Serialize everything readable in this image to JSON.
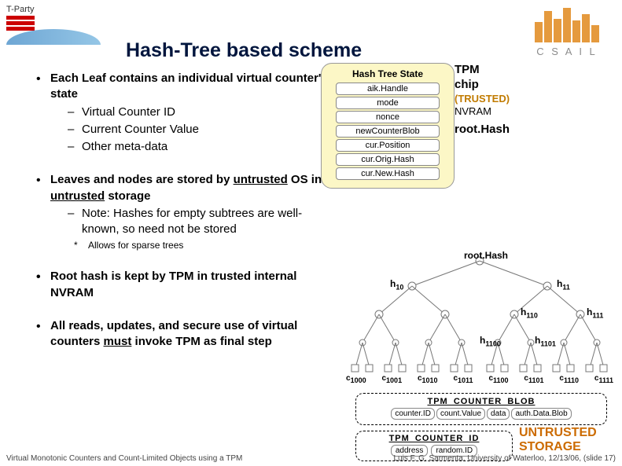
{
  "logos": {
    "left_label": "T-Party",
    "right_label": "C S A I L"
  },
  "title": "Hash-Tree based scheme",
  "hashtree_state": {
    "label": "Hash Tree State",
    "fields": [
      "aik.Handle",
      "mode",
      "nonce",
      "newCounterBlob",
      "cur.Position",
      "cur.Orig.Hash",
      "cur.New.Hash"
    ]
  },
  "tpm": {
    "title1": "TPM",
    "title2": "chip",
    "trusted": "(TRUSTED)",
    "nvram": "NVRAM",
    "roothash": "root.Hash"
  },
  "bullets": {
    "b1": {
      "main_a": "Each Leaf contains an individual virtual counter's state",
      "s1": "Virtual Counter ID",
      "s2": "Current Counter Value",
      "s3": "Other meta-data"
    },
    "b2": {
      "main": "Leaves and nodes are stored by untrusted OS in untrusted storage",
      "s1": "Note: Hashes for empty subtrees are well-known, so need not be stored",
      "ss1": "Allows for sparse trees"
    },
    "b3": "Root hash is kept by TPM in trusted internal NVRAM",
    "b4": "All reads, updates, and secure use of virtual counters must invoke TPM as final step"
  },
  "tree": {
    "root": "root.Hash",
    "h10": "h",
    "h10s": "10",
    "h11": "h",
    "h11s": "11",
    "h110": "h",
    "h110s": "110",
    "h111": "h",
    "h111s": "111",
    "h1100": "h",
    "h1100s": "1100",
    "h1101": "h",
    "h1101s": "1101",
    "leaves": [
      "c",
      "c",
      "c",
      "c",
      "c",
      "c",
      "c",
      "c"
    ],
    "leaf_subs": [
      "1000",
      "1001",
      "1010",
      "1011",
      "1100",
      "1101",
      "1110",
      "1111"
    ]
  },
  "blob": {
    "label": "TPM_COUNTER_BLOB",
    "cells": [
      "counter.ID",
      "count.Value",
      "data",
      "auth.Data.Blob"
    ]
  },
  "idbox": {
    "label": "TPM_COUNTER_ID",
    "cells": [
      "address",
      "random.ID"
    ]
  },
  "untrusted": {
    "l1": "UNTRUSTED",
    "l2": "STORAGE"
  },
  "footer": {
    "left": "Virtual Monotonic Counters and Count-Limited Objects using a TPM",
    "right": "Luis F. G. Sarmenta, University of Waterloo, 12/13/06, (slide 17)"
  }
}
